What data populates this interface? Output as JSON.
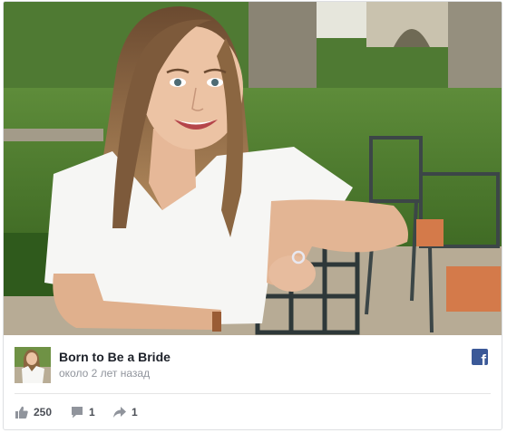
{
  "post": {
    "author": "Born to Be a Bride",
    "timestamp": "около 2 лет назад",
    "photo_icon": "photo-of-woman-in-white-shirt",
    "avatar_icon": "page-avatar",
    "network_icon": "facebook-icon"
  },
  "stats": {
    "likes": "250",
    "comments": "1",
    "shares": "1"
  },
  "colors": {
    "facebook_blue": "#3b5998",
    "title_text": "#1d2129",
    "meta_text": "#90949c",
    "action_text": "#4b4f56"
  }
}
